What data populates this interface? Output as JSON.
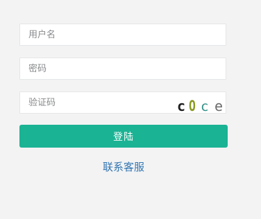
{
  "login": {
    "username_placeholder": "用户名",
    "password_placeholder": "密码",
    "captcha_placeholder": "验证码",
    "captcha_chars": [
      "c",
      "O",
      "c",
      "e"
    ],
    "captcha_colors": [
      "#1f1f1f",
      "#8a9a22",
      "#2f8f86",
      "#6b6b6b"
    ],
    "submit_label": "登陆",
    "contact_label": "联系客服"
  },
  "colors": {
    "primary": "#1ab394",
    "link": "#3276b1",
    "background": "#f3f3f4"
  }
}
